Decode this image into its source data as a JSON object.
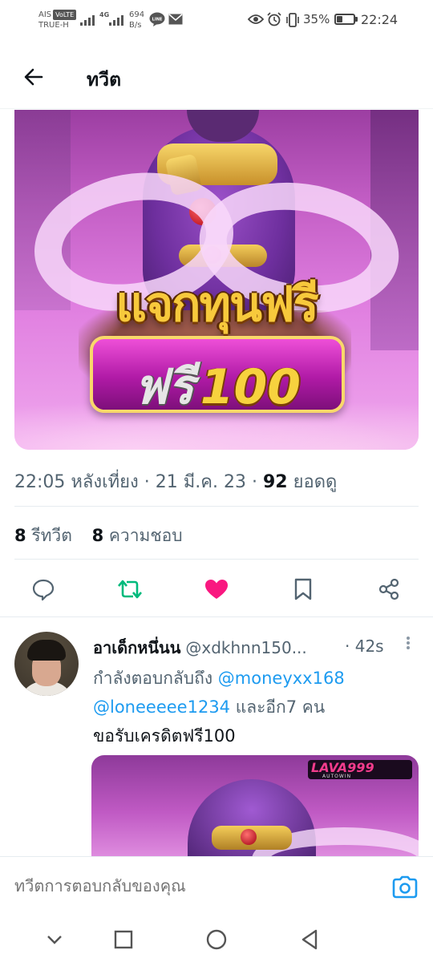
{
  "status_bar": {
    "carrier_line1": "AIS",
    "volte_badge": "VoLTE",
    "carrier_line2": "TRUE-H",
    "network": "4G",
    "speed_value": "694",
    "speed_unit": "B/s",
    "line_icon": "LINE",
    "battery_percent": "35%",
    "battery_level": 0.35,
    "time": "22:24"
  },
  "header": {
    "title": "ทวีต"
  },
  "tweet": {
    "media": {
      "headline": "แจกทุนฟรี",
      "pill_free": "ฟรี",
      "pill_number": "100"
    },
    "time": "22:05 หลังเที่ยง",
    "date": "21 มี.ค. 23",
    "separator": "·",
    "views_count": "92",
    "views_label": "ยอดดู",
    "retweets_count": "8",
    "retweets_label": "รีทวีต",
    "likes_count": "8",
    "likes_label": "ความชอบ"
  },
  "actions": {
    "reply_icon": "comment-icon",
    "retweet_icon": "retweet-icon",
    "like_icon": "heart-icon",
    "bookmark_icon": "bookmark-icon",
    "share_icon": "share-icon",
    "retweet_color": "#00ba7c",
    "like_color": "#f91880"
  },
  "reply": {
    "name": "อาเด็กหนึ่นน",
    "handle": "@xdkhnn150...",
    "time": "· 42s",
    "replying_prefix": "กำลังตอบกลับถึง",
    "mention_1": "@moneyxx168",
    "mention_2": "@loneeeee1234",
    "replying_suffix": "และอีก7 คน",
    "text": "ขอรับเครดิตฟรี100",
    "media_logo": "LAVA999",
    "media_logo_sub": "AUTOWIN"
  },
  "compose": {
    "placeholder": "ทวีตการตอบกลับของคุณ"
  },
  "colors": {
    "accent": "#1d9bf0",
    "text_primary": "#0f1419",
    "text_secondary": "#536471"
  }
}
